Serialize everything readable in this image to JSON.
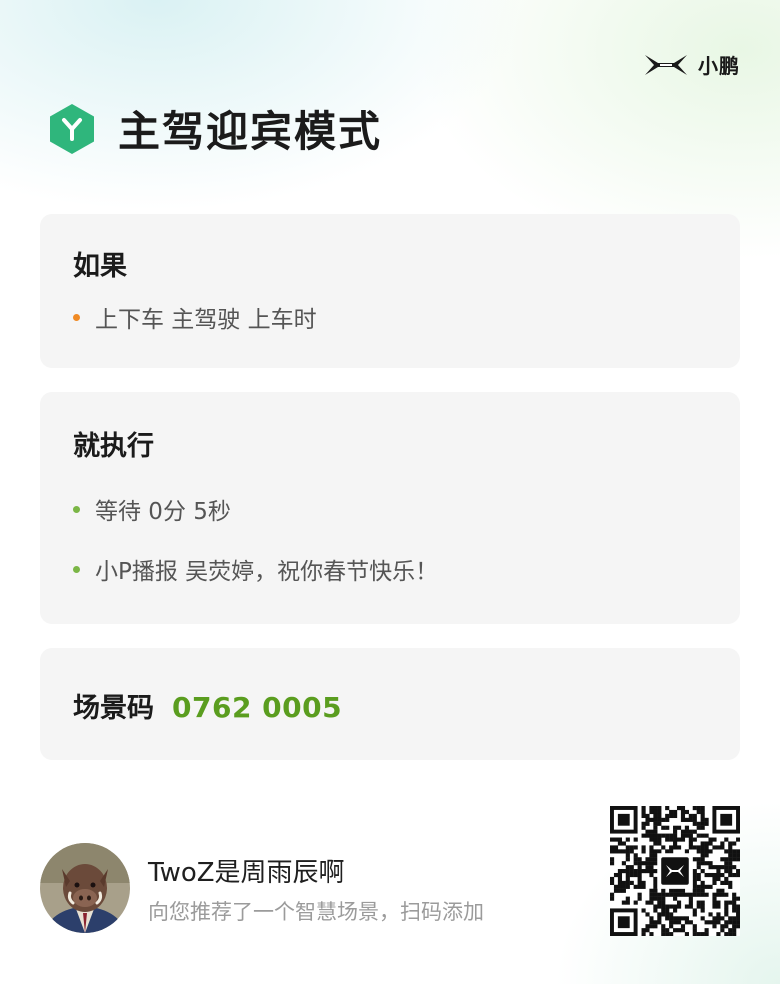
{
  "brand": {
    "name": "小鹏"
  },
  "header": {
    "title": "主驾迎宾模式"
  },
  "condition_card": {
    "title": "如果",
    "items": [
      "上下车 主驾驶 上车时"
    ],
    "dot_color": "#f08a24"
  },
  "action_card": {
    "title": "就执行",
    "items": [
      "等待 0分 5秒",
      "小P播报 吴荧婷，祝你春节快乐！"
    ],
    "dot_color": "#7bb646"
  },
  "code_card": {
    "label": "场景码",
    "value": "0762 0005",
    "value_color": "#5a9d1f"
  },
  "footer": {
    "username": "TwoZ是周雨辰啊",
    "subtitle": "向您推荐了一个智慧场景，扫码添加"
  },
  "colors": {
    "accent_green": "#2fb67c",
    "card_bg": "#f5f5f5"
  }
}
